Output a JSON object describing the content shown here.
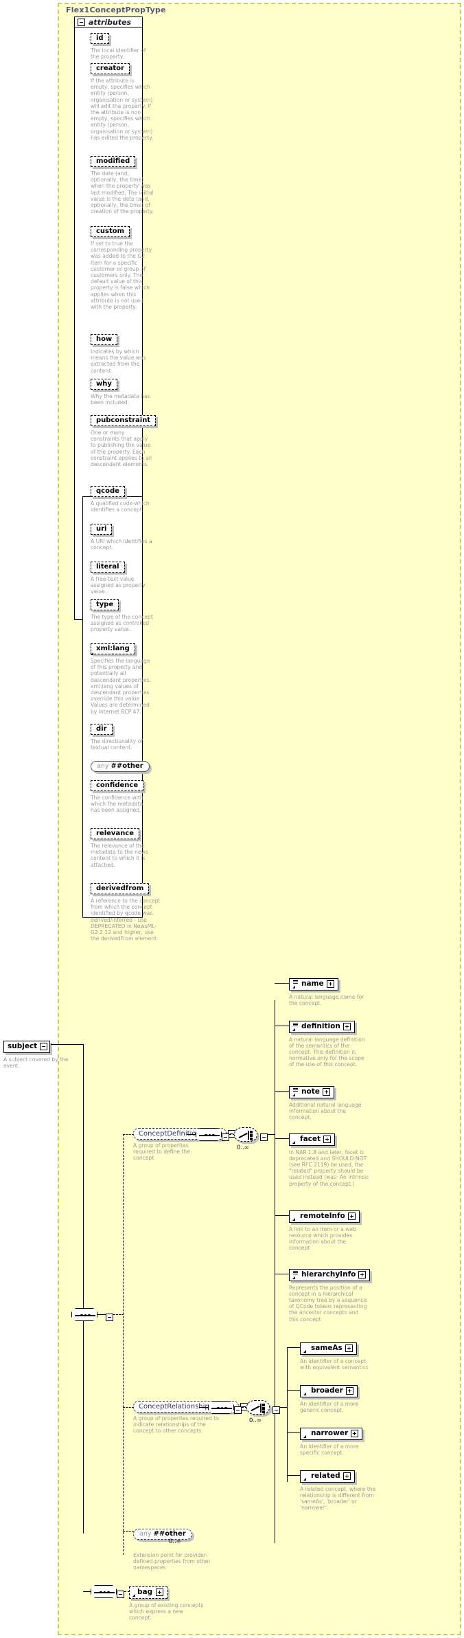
{
  "diagram": {
    "type": "xsd-schema-documentation",
    "complex_type_title": "Flex1ConceptPropType",
    "attributes_label": "attributes"
  },
  "attributes": [
    {
      "name": "id",
      "desc": "The local identifier of the property."
    },
    {
      "name": "creator",
      "desc": "If the attribute is empty, specifies which entity (person, organisation or system) will edit the property. If the attribute is non-empty, specifies which entity (person, organisation or system) has edited the property."
    },
    {
      "name": "modified",
      "desc": "The date (and, optionally, the time) when the property was last modified. The initial value is the date (and, optionally, the time) of creation of the property."
    },
    {
      "name": "custom",
      "desc": "If set to true the corresponding property was added to the G2 Item for a specific customer or group of customers only. The default value of this property is false which applies when this attribute is not used with the property."
    },
    {
      "name": "how",
      "desc": "Indicates by which means the value was extracted from the content."
    },
    {
      "name": "why",
      "desc": "Why the metadata has been included."
    },
    {
      "name": "pubconstraint",
      "desc": "One or many constraints that apply to publishing the value of the property. Each constraint applies to all descendant elements."
    },
    {
      "name": "qcode",
      "desc": "A qualified code which identifies a concept."
    },
    {
      "name": "uri",
      "desc": "A URI which identifies a concept."
    },
    {
      "name": "literal",
      "desc": "A free-text value assigned as property value."
    },
    {
      "name": "type",
      "desc": "The type of the concept assigned as controlled property value."
    },
    {
      "name": "xml:lang",
      "desc": "Specifies the language of this property and potentially all descendant properties. xml:lang values of descendant properties override this value. Values are determined by Internet BCP 47."
    },
    {
      "name": "dir",
      "desc": "The directionality of textual content."
    },
    {
      "name": "any ##other",
      "desc": "",
      "kind": "any",
      "any_prefix": "any",
      "any_name": "##other"
    },
    {
      "name": "confidence",
      "desc": "The confidence with which the metadata has been assigned."
    },
    {
      "name": "relevance",
      "desc": "The relevance of the metadata to the news content to which it is attached."
    },
    {
      "name": "derivedfrom",
      "desc": "A reference to the concept from which the concept identified by qcode was derived/inferred - use DEPRECATED in NewsML-G2 2.12 and higher, use the derivedFrom element"
    }
  ],
  "root_element": {
    "name": "subject",
    "desc": "A subject covered by the event."
  },
  "groups": [
    {
      "id": "concept_definition_group",
      "name": "ConceptDefinitionGroup",
      "desc": "A group of properites required to define the concept",
      "occurrence": "0..∞",
      "children": [
        {
          "name": "name",
          "desc": "A natural language name for the concept."
        },
        {
          "name": "definition",
          "desc": "A natural language definition of the semantics of the concept. This definition is normative only for the scope of the use of this concept."
        },
        {
          "name": "note",
          "desc": "Additional natural language information about the concept."
        },
        {
          "name": "facet",
          "desc": "In NAR 1.8 and later, facet is deprecated and SHOULD NOT (see RFC 2119) be used, the \"related\" property should be used instead (was: An intrinsic property of the concept.)"
        },
        {
          "name": "remoteInfo",
          "desc": "A link to an item or a web resource which provides information about the concept"
        },
        {
          "name": "hierarchyInfo",
          "desc": "Represents the position of a concept in a hierarchical taxonomy tree by a sequence of QCode tokens representing the ancestor concepts and this concept"
        }
      ]
    },
    {
      "id": "concept_relationships_group",
      "name": "ConceptRelationshipsGroup",
      "desc": "A group of properites required to indicate relationships of the concept to other concepts",
      "occurrence": "0..∞",
      "children": [
        {
          "name": "sameAs",
          "desc": "An identifier of a concept with equivalent semantics"
        },
        {
          "name": "broader",
          "desc": "An identifier of a more generic concept."
        },
        {
          "name": "narrower",
          "desc": "An identifier of a more specific concept."
        },
        {
          "name": "related",
          "desc": "A related concept, where the relationship is different from 'sameAs', 'broader' or 'narrower'."
        }
      ]
    }
  ],
  "extension": {
    "any_prefix": "any",
    "any_name": "##other",
    "occurrence": "0..∞",
    "desc": "Extension point for provider-defined properties from other namespaces"
  },
  "bag": {
    "name": "bag",
    "desc": "A group of existing concepts which express a new concept."
  },
  "colors": {
    "panel_background": "#ffffcc",
    "panel_border": "#cccc66",
    "node_fill": "#ffffff",
    "node_border": "#000000",
    "description_text": "#9a9a9a",
    "title_text": "#555577",
    "group_text": "#33335c",
    "shadow": "#c0c0c0"
  }
}
